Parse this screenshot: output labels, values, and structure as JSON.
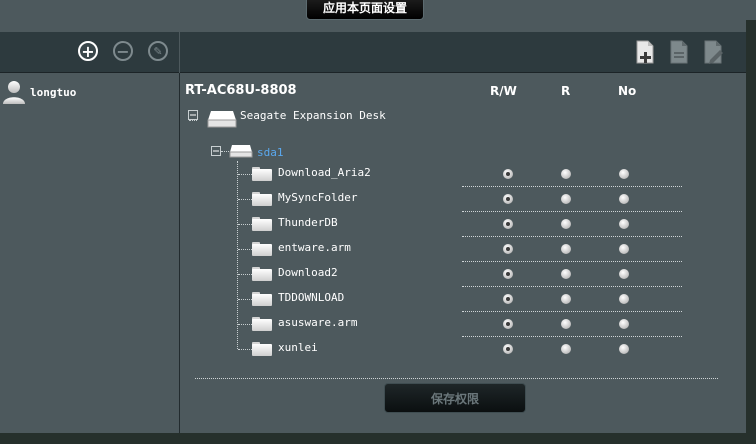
{
  "header": {
    "apply_label": "应用本页面设置"
  },
  "left_toolbar": {
    "buttons": [
      {
        "icon": "plus-circle-icon",
        "active": true
      },
      {
        "icon": "minus-circle-icon",
        "active": false
      },
      {
        "icon": "edit-circle-icon",
        "active": false
      }
    ]
  },
  "users": [
    {
      "name": "longtuo",
      "icon": "user-icon"
    }
  ],
  "right_toolbar": {
    "buttons": [
      {
        "icon": "add-document-icon"
      },
      {
        "icon": "document-icon"
      },
      {
        "icon": "edit-document-icon"
      }
    ]
  },
  "permissions": {
    "router": "RT-AC68U-8808",
    "columns": [
      "R/W",
      "R",
      "No"
    ],
    "disk": "Seagate Expansion Desk",
    "partition": "sda1",
    "folders": [
      {
        "name": "Download_Aria2",
        "selected": "R/W"
      },
      {
        "name": "MySyncFolder",
        "selected": "R/W"
      },
      {
        "name": "ThunderDB",
        "selected": "R/W"
      },
      {
        "name": "entware.arm",
        "selected": "R/W"
      },
      {
        "name": "Download2",
        "selected": "R/W"
      },
      {
        "name": "TDDOWNLOAD",
        "selected": "R/W"
      },
      {
        "name": "asusware.arm",
        "selected": "R/W"
      },
      {
        "name": "xunlei",
        "selected": "R/W"
      }
    ],
    "save_label": "保存权限"
  },
  "colors": {
    "panel": "#4d595d",
    "toolbar": "#2d3a3e",
    "partition_link": "#5aa8ee"
  }
}
